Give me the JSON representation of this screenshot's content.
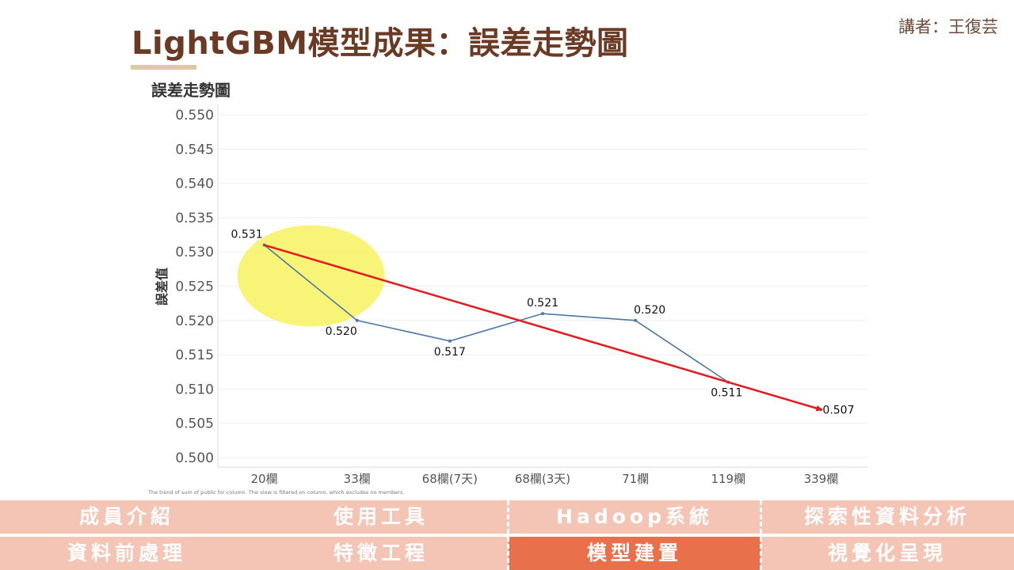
{
  "header": {
    "title": "LightGBM模型成果：誤差走勢圖",
    "speaker": "講者：王復芸"
  },
  "chart_data": {
    "type": "line",
    "title": "誤差走勢圖",
    "xlabel": "",
    "ylabel": "誤差值",
    "categories": [
      "20欄",
      "33欄",
      "68欄(7天)",
      "68欄(3天)",
      "71欄",
      "119欄",
      "339欄"
    ],
    "series": [
      {
        "values": [
          0.531,
          0.52,
          0.517,
          0.521,
          0.52,
          0.511,
          0.507
        ],
        "color": "#4e79a7"
      }
    ],
    "data_labels": [
      "0.531",
      "0.520",
      "0.517",
      "0.521",
      "0.520",
      "0.511",
      "0.507"
    ],
    "ylim": [
      0.5,
      0.55
    ],
    "yticks": [
      "0.500",
      "0.505",
      "0.510",
      "0.515",
      "0.520",
      "0.525",
      "0.530",
      "0.535",
      "0.540",
      "0.545",
      "0.550"
    ],
    "trend_line": {
      "from": 0.531,
      "to": 0.507,
      "color": "#e8191e"
    },
    "highlight": {
      "category": "20欄",
      "value": 0.5265,
      "color": "#f7f25a"
    },
    "grid": true,
    "footnote": "The trend of sum of public for column. The view is filtered on column, which excludes no members."
  },
  "nav": {
    "row1": [
      "成員介紹",
      "使用工具",
      "Hadoop系統",
      "探索性資料分析"
    ],
    "row2": [
      "資料前處理",
      "特徵工程",
      "模型建置",
      "視覺化呈現"
    ],
    "active": "模型建置",
    "bg_color": "#f4c4b5",
    "active_color": "#e8704b"
  }
}
